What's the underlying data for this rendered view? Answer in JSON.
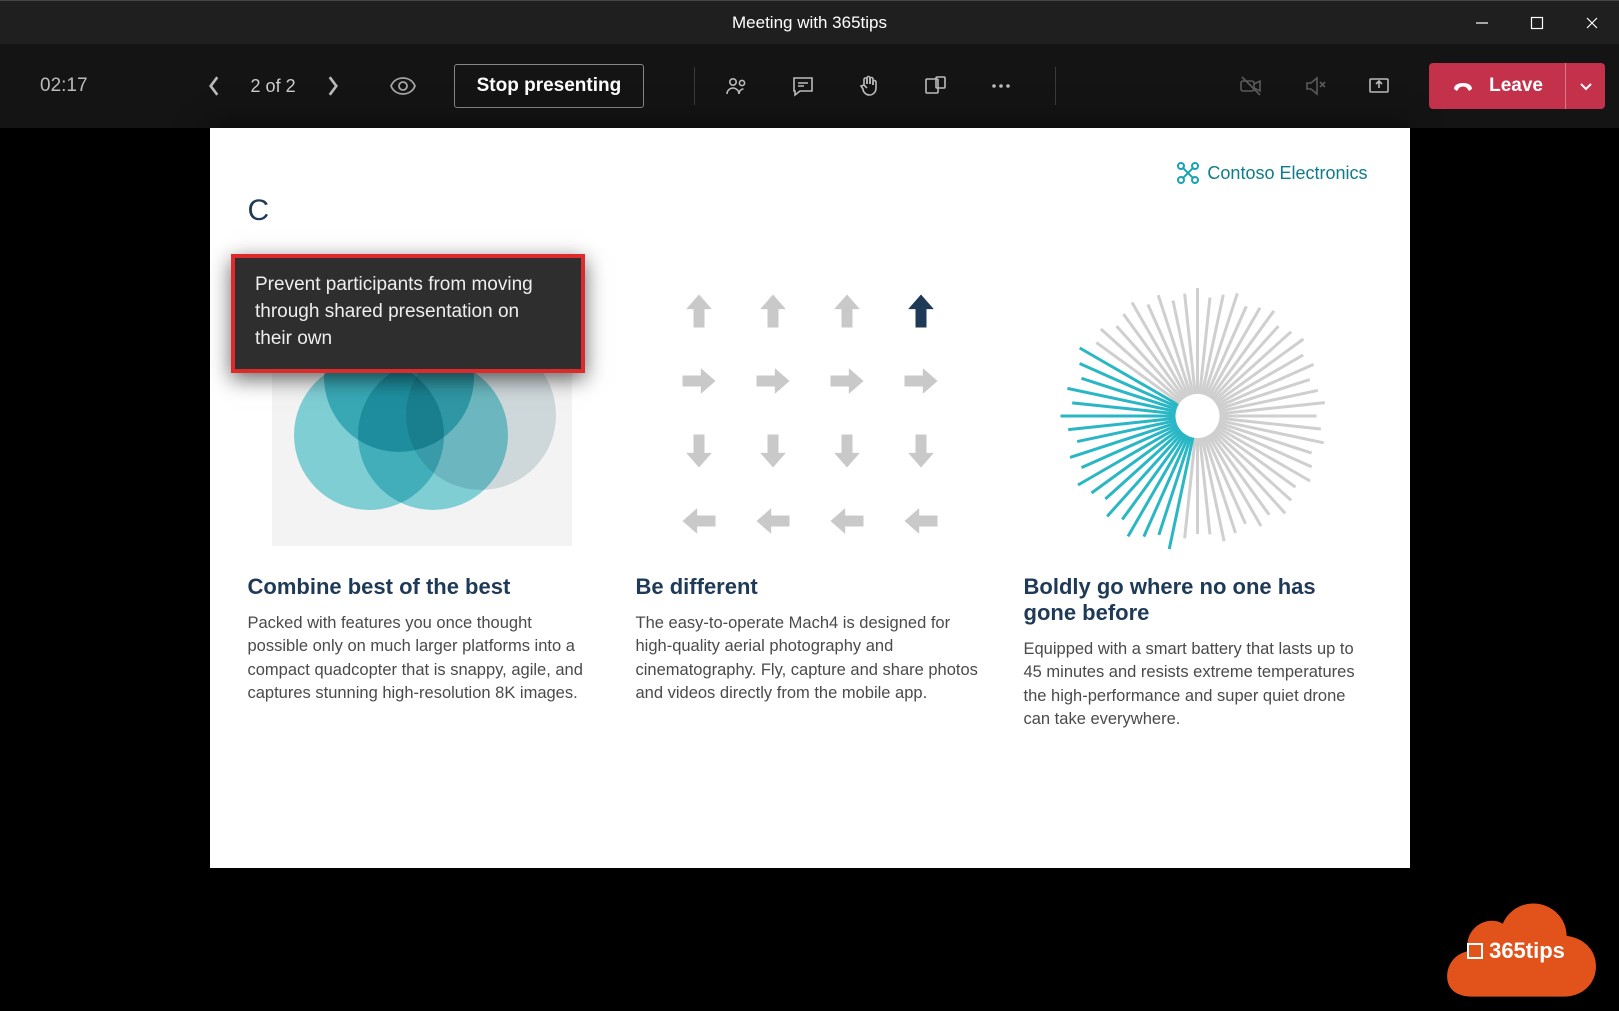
{
  "window": {
    "title": "Meeting with 365tips"
  },
  "toolbar": {
    "timer": "02:17",
    "slide_count": "2 of 2",
    "stop_label": "Stop presenting",
    "leave_label": "Leave"
  },
  "tooltip": {
    "text": "Prevent participants from moving through shared presentation on their own"
  },
  "slide": {
    "brand": "Contoso Electronics",
    "title_partial": "C",
    "columns": [
      {
        "heading": "Combine best of the best",
        "body": "Packed with features you once thought possible only on much larger platforms into a compact quadcopter that is snappy, agile, and captures stunning high-resolution 8K images."
      },
      {
        "heading": "Be different",
        "body": "The easy-to-operate Mach4 is designed for high-quality aerial photography and cinematography. Fly, capture and share photos and videos directly from the mobile app."
      },
      {
        "heading": "Boldly go where no one has gone before",
        "body": "Equipped with a smart battery that lasts up to 45 minutes and resists extreme temperatures the high-performance and super quiet drone can take everywhere."
      }
    ]
  },
  "watermark": {
    "text": "365tips"
  }
}
